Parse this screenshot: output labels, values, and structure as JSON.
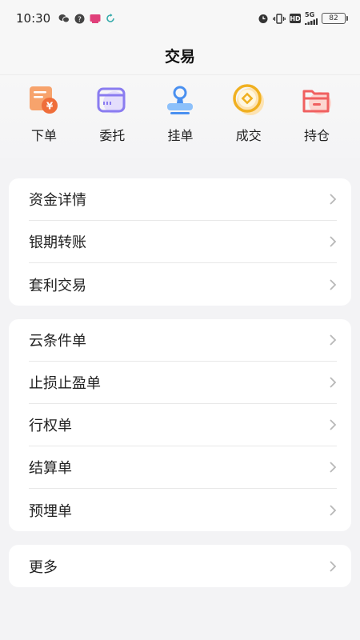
{
  "status_bar": {
    "time": "10:30",
    "network_tag": "5G",
    "battery": "82"
  },
  "header": {
    "title": "交易"
  },
  "quick_actions": [
    {
      "label": "下单",
      "icon": "order-icon"
    },
    {
      "label": "委托",
      "icon": "entrust-icon"
    },
    {
      "label": "挂单",
      "icon": "pending-order-icon"
    },
    {
      "label": "成交",
      "icon": "deal-icon"
    },
    {
      "label": "持仓",
      "icon": "position-icon"
    }
  ],
  "groups": [
    {
      "items": [
        "资金详情",
        "银期转账",
        "套利交易"
      ]
    },
    {
      "items": [
        "云条件单",
        "止损止盈单",
        "行权单",
        "结算单",
        "预埋单"
      ]
    },
    {
      "items": [
        "更多"
      ]
    }
  ],
  "colors": {
    "background": "#f3f3f5",
    "card": "#ffffff",
    "order_icon": "#f0783c",
    "entrust_icon": "#8a7cf0",
    "pending_icon": "#4a90f0",
    "deal_icon": "#f0b020",
    "position_icon": "#f06060"
  }
}
